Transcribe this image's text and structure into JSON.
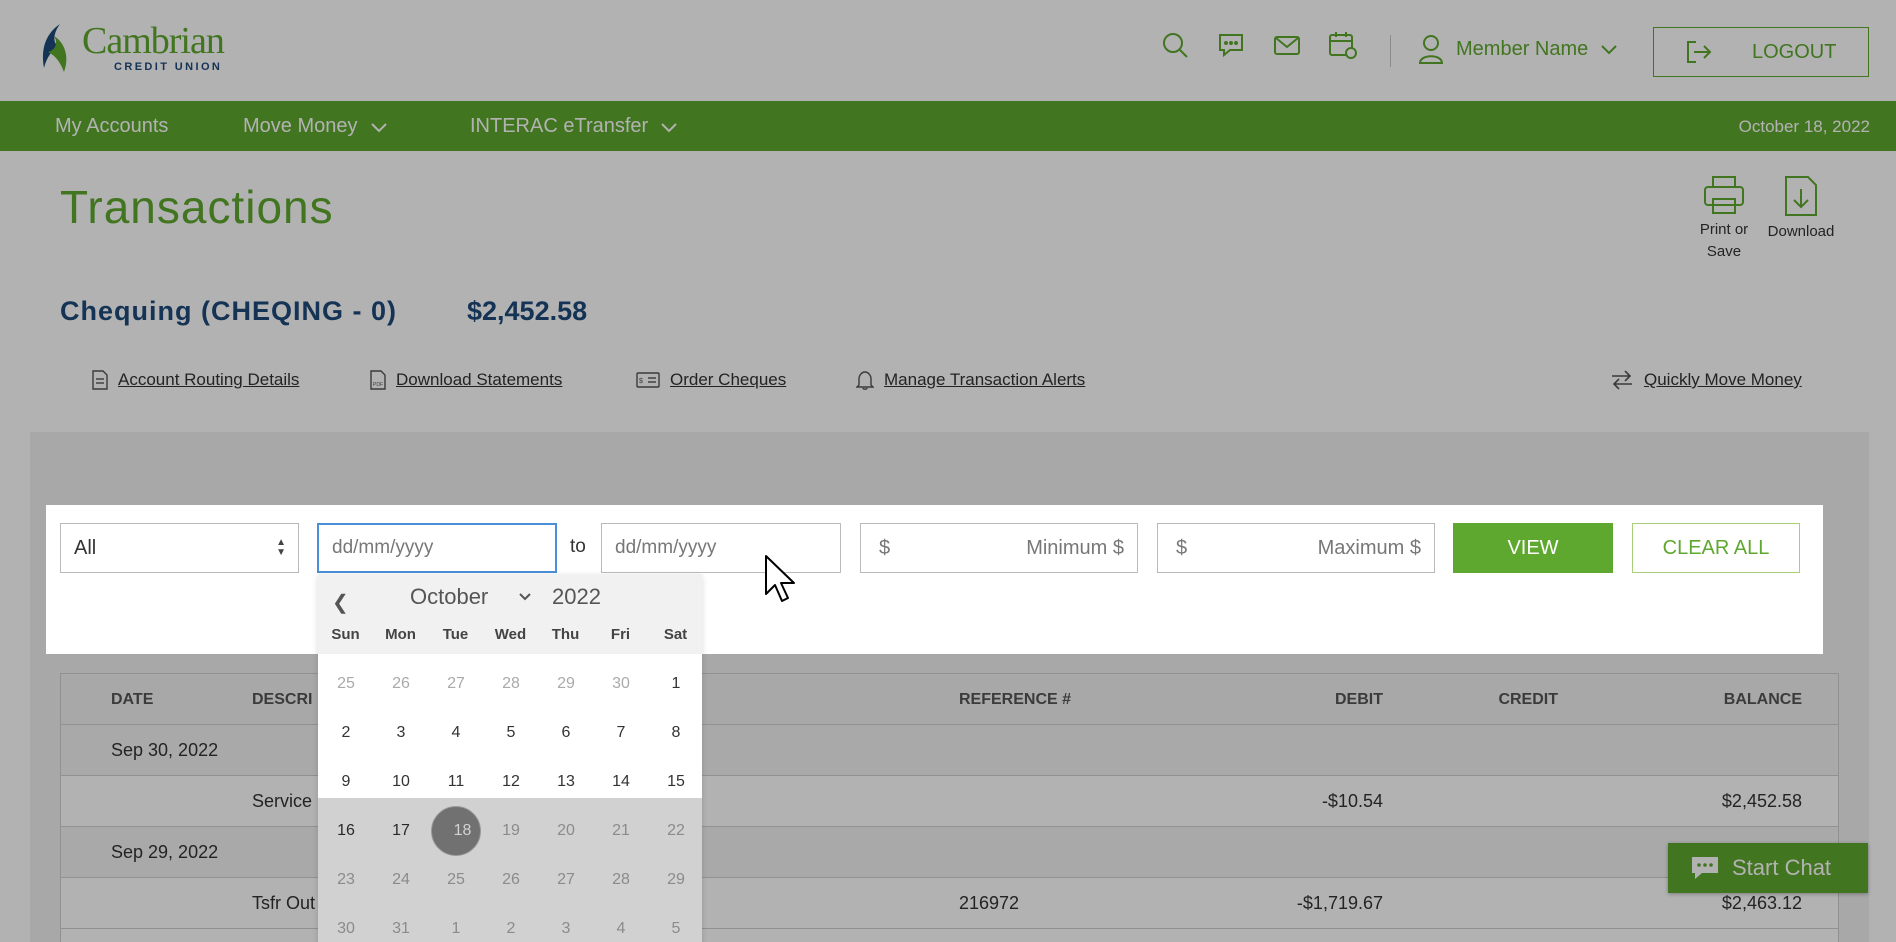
{
  "brand": {
    "name": "Cambrian",
    "sub": "CREDIT UNION",
    "primary": "#5fa82f",
    "navy": "#1e4a7a"
  },
  "header": {
    "icons": [
      "search-icon",
      "chat-icon",
      "mail-icon",
      "calendar-icon"
    ],
    "member_name": "Member Name",
    "logout_label": "LOGOUT"
  },
  "nav": {
    "items": [
      {
        "label": "My Accounts"
      },
      {
        "label": "Move Money"
      },
      {
        "label": "INTERAC eTransfer"
      }
    ],
    "date": "October 18, 2022"
  },
  "page": {
    "title": "Transactions",
    "print_label": "Print or Save",
    "download_label": "Download"
  },
  "account": {
    "name": "Chequing (CHEQING - 0)",
    "balance": "$2,452.58"
  },
  "links": {
    "routing": "Account Routing Details",
    "statements": "Download Statements",
    "cheques": "Order Cheques",
    "alerts": "Manage Transaction Alerts",
    "move": "Quickly Move Money"
  },
  "filters": {
    "type_value": "All",
    "from_placeholder": "dd/mm/yyyy",
    "to_label": "to",
    "to_placeholder": "dd/mm/yyyy",
    "currency": "$",
    "min_placeholder": "Minimum $",
    "max_placeholder": "Maximum $",
    "view_label": "VIEW",
    "clear_label": "CLEAR ALL"
  },
  "table": {
    "headers": {
      "date": "DATE",
      "description": "DESCRI",
      "reference": "REFERENCE #",
      "debit": "DEBIT",
      "credit": "CREDIT",
      "balance": "BALANCE"
    },
    "rows": [
      {
        "group": "Sep 30, 2022"
      },
      {
        "description": "Service",
        "reference": "",
        "debit": "-$10.54",
        "credit": "",
        "balance": "$2,452.58"
      },
      {
        "group": "Sep 29, 2022"
      },
      {
        "description": "Tsfr Out",
        "reference": "216972",
        "debit": "-$1,719.67",
        "credit": "",
        "balance": "$2,463.12"
      }
    ]
  },
  "calendar": {
    "month": "October",
    "year": "2022",
    "days_of_week": [
      "Sun",
      "Mon",
      "Tue",
      "Wed",
      "Thu",
      "Fri",
      "Sat"
    ],
    "weeks": [
      [
        "25",
        "26",
        "27",
        "28",
        "29",
        "30",
        "1"
      ],
      [
        "2",
        "3",
        "4",
        "5",
        "6",
        "7",
        "8"
      ],
      [
        "9",
        "10",
        "11",
        "12",
        "13",
        "14",
        "15"
      ],
      [
        "16",
        "17",
        "18",
        "19",
        "20",
        "21",
        "22"
      ],
      [
        "23",
        "24",
        "25",
        "26",
        "27",
        "28",
        "29"
      ],
      [
        "30",
        "31",
        "1",
        "2",
        "3",
        "4",
        "5"
      ]
    ],
    "selected": "18"
  },
  "chat": {
    "label": "Start Chat"
  }
}
